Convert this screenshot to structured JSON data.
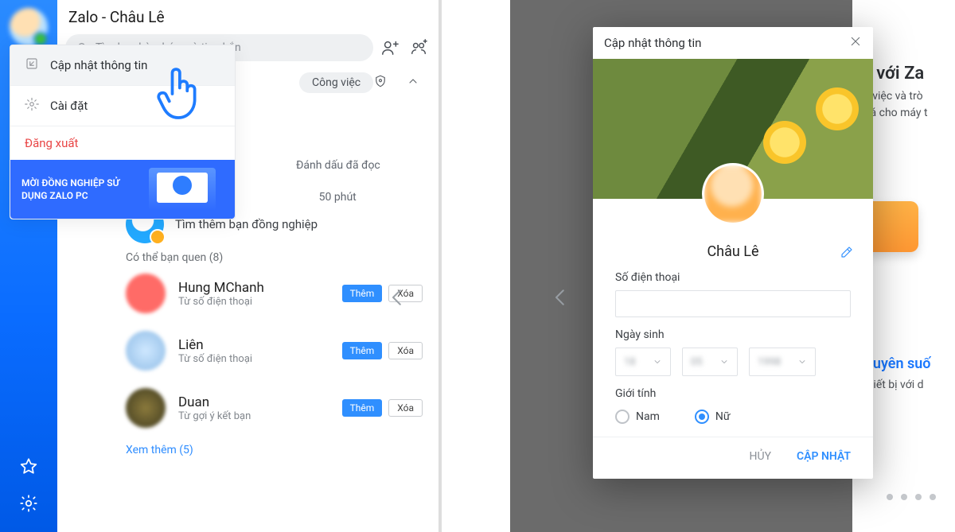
{
  "header": {
    "title": "Zalo - Châu Lê"
  },
  "search": {
    "placeholder": "Tìm bạn bè, nhóm và tin nhắn"
  },
  "menu": {
    "update_info": "Cập nhật thông tin",
    "settings": "Cài đặt",
    "logout": "Đăng xuất",
    "banner": "MỜI ĐỒNG NGHIỆP SỬ DỤNG ZALO PC"
  },
  "chips": {
    "work": "Công việc"
  },
  "sidepeek": {
    "mark_read": "Đánh dấu đã đọc",
    "time": "50 phút",
    "find_colleague": "Tìm thêm bạn đồng nghiệp"
  },
  "suggest": {
    "header": "Có thể bạn quen (8)",
    "items": [
      {
        "name": "Hung MChanh",
        "from": "Từ số điện thoại",
        "av": "hm"
      },
      {
        "name": "Liên",
        "from": "Từ số điện thoại",
        "av": "l"
      },
      {
        "name": "Duan",
        "from": "Từ gợi ý kết bạn",
        "av": "d"
      }
    ],
    "add": "Thêm",
    "del": "Xóa",
    "see_more": "Xem thêm (5)"
  },
  "right_bg": {
    "title": "đến với Za",
    "line1": "ợ làm việc và trò",
    "line2": "ưu hoá cho máy t",
    "sec_title": "ệm xuyên suố",
    "sec_sub": "mọi thiết bị với d"
  },
  "modal": {
    "title": "Cập nhật thông tin",
    "name": "Châu Lê",
    "phone_label": "Số điện thoại",
    "phone_value": "",
    "dob_label": "Ngày sinh",
    "gender_label": "Giới tính",
    "gender_male": "Nam",
    "gender_female": "Nữ",
    "cancel": "HỦY",
    "submit": "CẬP NHẬT"
  }
}
